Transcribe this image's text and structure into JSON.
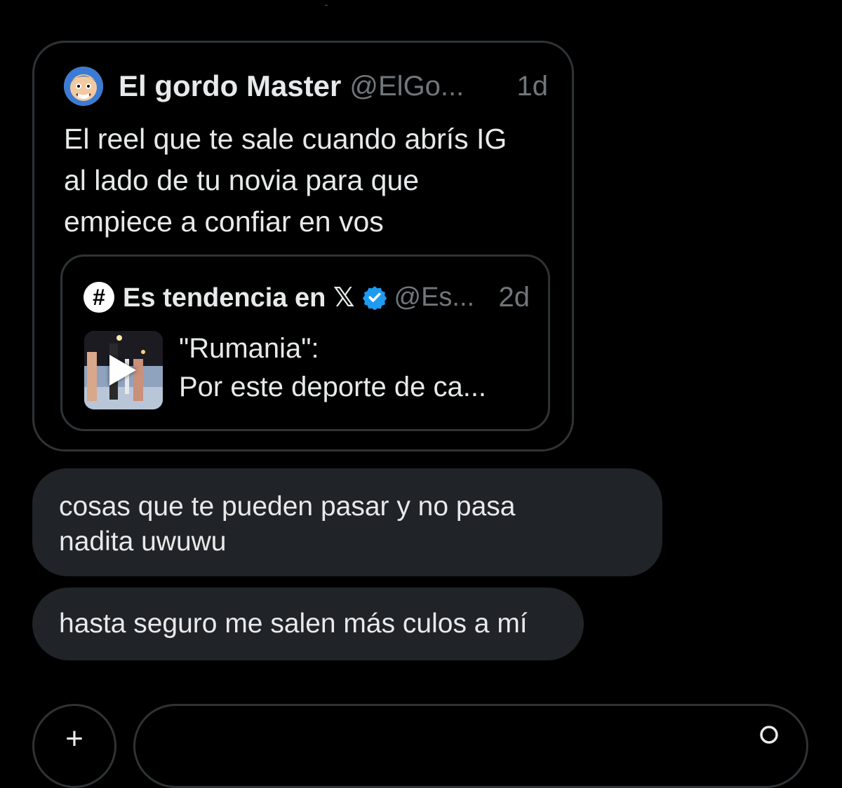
{
  "tweet": {
    "author_name": "El gordo Master",
    "author_handle": "@ElGo...",
    "time": "1d",
    "text_lines": [
      "El reel que te sale cuando abrís IG",
      "al lado de tu novia para que",
      "empiece a confiar en vos"
    ],
    "quoted": {
      "icon_label": "#",
      "name": "Es tendencia en 𝕏",
      "handle": "@Es...",
      "time": "2d",
      "text_lines": [
        "\"Rumania\":",
        "Por este deporte de ca..."
      ]
    }
  },
  "messages": [
    {
      "lines": [
        "cosas que te pueden pasar y no pasa",
        "nadita uwuwu"
      ]
    },
    {
      "lines": [
        "hasta seguro me salen más culos a mí"
      ]
    }
  ],
  "compose": {
    "add_label": "+",
    "placeholder": ""
  },
  "icons": {
    "avatar": "cartoon-avatar-icon",
    "verified": "verified-badge-icon",
    "play": "play-icon",
    "search": "search-icon"
  },
  "colors": {
    "background": "#000000",
    "text": "#e7e9ea",
    "muted": "#71767b",
    "border": "#2f3336",
    "bubble": "#202327",
    "verified": "#1d9bf0"
  }
}
